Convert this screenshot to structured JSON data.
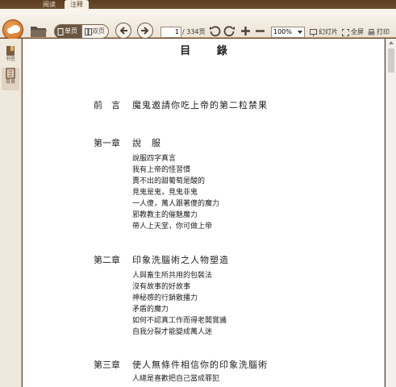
{
  "tabs": [
    {
      "label": "阅读"
    },
    {
      "label": "注释"
    }
  ],
  "toolbar": {
    "single_page_label": "单页",
    "double_page_label": "双页",
    "current_page": "1",
    "total_pages": "/ 334页",
    "zoom": "100%",
    "slideshow_label": "幻灯片",
    "fullscreen_label": "全屏",
    "print_label": "打印"
  },
  "sidebar": {
    "items": [
      {
        "label": "书签",
        "icon": "bookmark-icon"
      },
      {
        "label": "目录",
        "icon": "toc-icon"
      }
    ]
  },
  "document": {
    "title": "目 錄",
    "preface": {
      "label": "前　言",
      "title": "魔鬼邀請你吃上帝的第二粒禁果"
    },
    "chapters": [
      {
        "label": "第一章",
        "title": "說　服",
        "items": [
          "說服四字真言",
          "我有上帝的怪習慣",
          "賣不出的甜葡萄是酸的",
          "見鬼是鬼，見鬼非鬼",
          "一人傻，萬人跟著傻的魔力",
          "邪教教主的催魅魔力",
          "帶人上天堂，你可做上帝"
        ]
      },
      {
        "label": "第二章",
        "title": "印象洗腦術之人物塑造",
        "items": [
          "人與畜生所共用的包裝法",
          "沒有故事的好故事",
          "神秘感的行銷散播力",
          "矛盾的魔力",
          "如何不認真工作而得老闆賞識",
          "自我分裂才能變成萬人迷"
        ]
      },
      {
        "label": "第三章",
        "title": "使人無條件相信你的印象洗腦術",
        "items": [
          "人總是喜歡把自己當成罪犯"
        ]
      }
    ]
  }
}
